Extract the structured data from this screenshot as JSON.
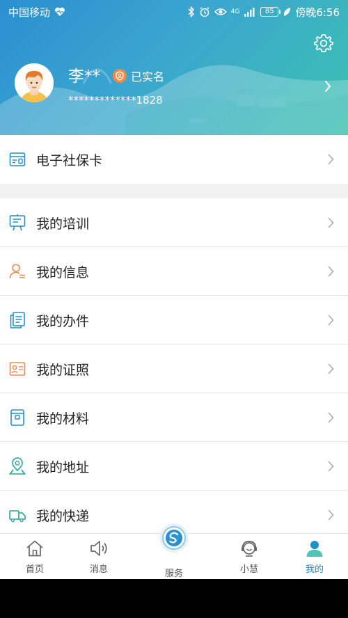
{
  "status_bar": {
    "carrier": "中国移动",
    "network": "4G",
    "battery": "85",
    "time": "傍晚6:56"
  },
  "profile": {
    "name": "李**",
    "verified_label": "已实名",
    "masked_id": "*************1828"
  },
  "menu": {
    "social_card": "电子社保卡",
    "items": [
      {
        "label": "我的培训",
        "icon": "training-icon"
      },
      {
        "label": "我的信息",
        "icon": "user-info-icon"
      },
      {
        "label": "我的办件",
        "icon": "documents-icon"
      },
      {
        "label": "我的证照",
        "icon": "certificate-icon"
      },
      {
        "label": "我的材料",
        "icon": "materials-icon"
      },
      {
        "label": "我的地址",
        "icon": "location-icon"
      },
      {
        "label": "我的快递",
        "icon": "delivery-truck-icon"
      }
    ]
  },
  "tabbar": {
    "home": "首页",
    "messages": "消息",
    "service": "服务",
    "assistant": "小慧",
    "mine": "我的"
  },
  "colors": {
    "accent": "#1f8fcf",
    "orange_icon": "#f08a4b",
    "teal_icon": "#26a69a"
  }
}
